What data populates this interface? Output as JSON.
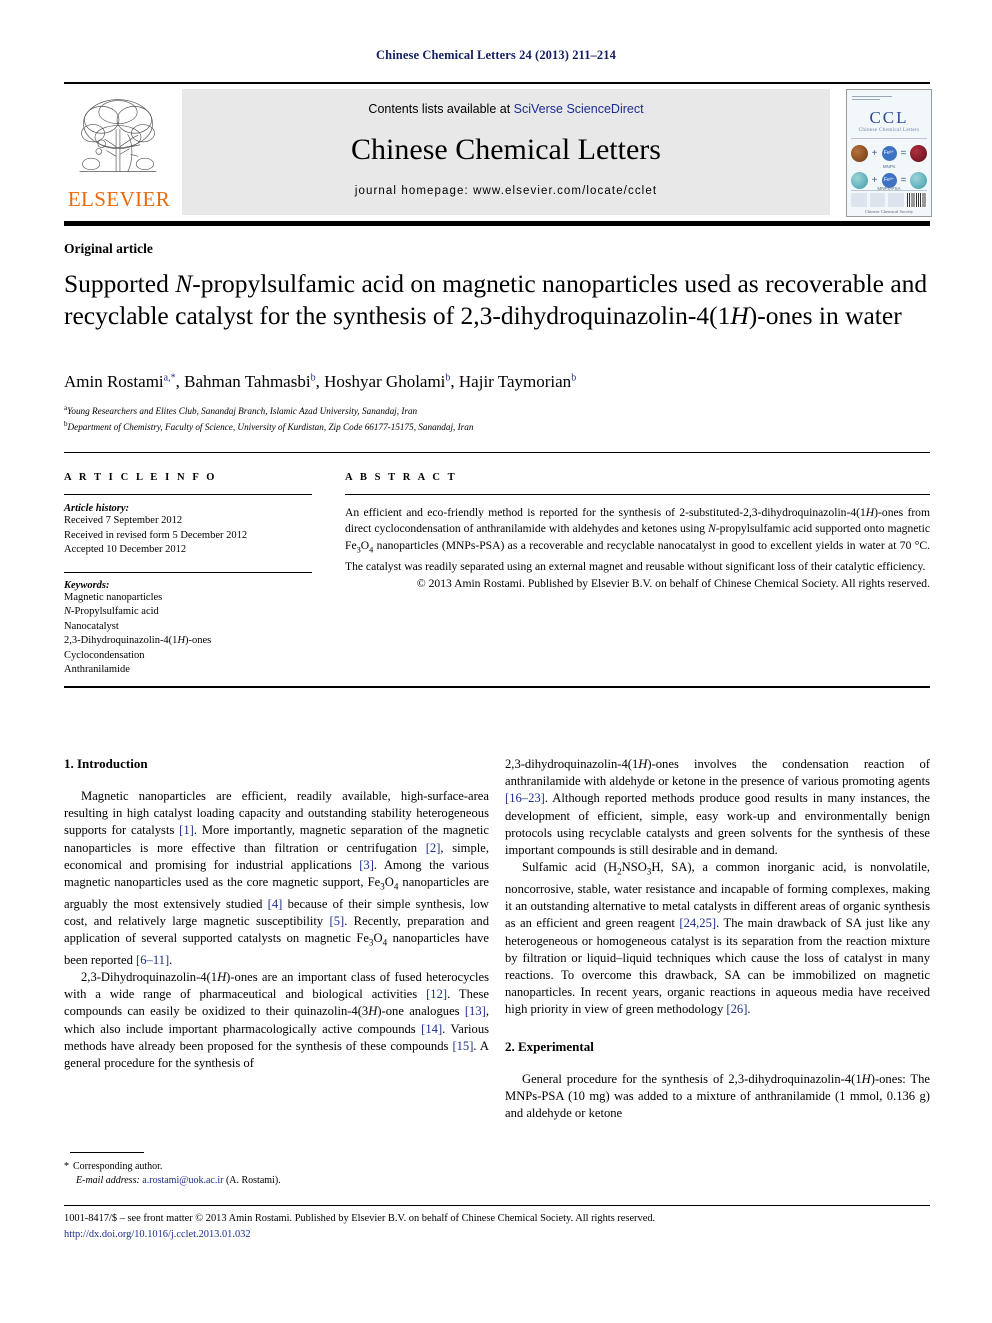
{
  "running_head": "Chinese Chemical Letters 24 (2013) 211–214",
  "masthead": {
    "publisher_name": "ELSEVIER",
    "contents_prefix": "Contents lists available at ",
    "contents_link": "SciVerse ScienceDirect",
    "journal_title": "Chinese Chemical Letters",
    "homepage": "journal homepage: www.elsevier.com/locate/cclet",
    "cover": {
      "acronym": "CCL",
      "subtitle": "Chinese Chemical Letters",
      "caption_1": "MNPs",
      "caption_2": "MNPs-PSA",
      "footer": "Chinese Chemical Society",
      "ion_label": "Fe³⁺"
    },
    "link_color": "#1c2e8c",
    "elsevier_orange": "#eb6909",
    "band_color": "#e8e8e8"
  },
  "article": {
    "type": "Original article",
    "title_part1": "Supported ",
    "title_italic1": "N",
    "title_part2": "-propylsulfamic acid on magnetic nanoparticles used as recoverable and recyclable catalyst for the synthesis of 2,3-dihydroquinazolin-4(1",
    "title_italic2": "H",
    "title_part3": ")-ones in water",
    "authors_plain": "Amin Rostami a,*, Bahman Tahmasbi b, Hoshyar Gholami b, Hajir Taymorian b",
    "authors": [
      {
        "name": "Amin Rostami",
        "marks": "a,*"
      },
      {
        "name": "Bahman Tahmasbi",
        "marks": "b"
      },
      {
        "name": "Hoshyar Gholami",
        "marks": "b"
      },
      {
        "name": "Hajir Taymorian",
        "marks": "b"
      }
    ],
    "affiliations": [
      {
        "mark": "a",
        "text": "Young Researchers and Elites Club, Sanandaj Branch, Islamic Azad University, Sanandaj, Iran"
      },
      {
        "mark": "b",
        "text": "Department of Chemistry, Faculty of Science, University of Kurdistan, Zip Code 66177-15175, Sanandaj, Iran"
      }
    ]
  },
  "article_info": {
    "label": "A R T I C L E  I N F O",
    "history_head": "Article history:",
    "history": [
      "Received 7 September 2012",
      "Received in revised form 5 December 2012",
      "Accepted 10 December 2012"
    ],
    "keywords_head": "Keywords:",
    "keywords": [
      "Magnetic nanoparticles",
      "N-Propylsulfamic acid",
      "Nanocatalyst",
      "2,3-Dihydroquinazolin-4(1H)-ones",
      "Cyclocondensation",
      "Anthranilamide"
    ]
  },
  "abstract": {
    "label": "A B S T R A C T",
    "body": "An efficient and eco-friendly method is reported for the synthesis of 2-substituted-2,3-dihydroquinazolin-4(1H)-ones from direct cyclocondensation of anthranilamide with aldehydes and ketones using N-propylsulfamic acid supported onto magnetic Fe3O4 nanoparticles (MNPs-PSA) as a recoverable and recyclable nanocatalyst in good to excellent yields in water at 70 °C. The catalyst was readily separated using an external magnet and reusable without significant loss of their catalytic efficiency.",
    "copyright": "© 2013 Amin Rostami. Published by Elsevier B.V. on behalf of Chinese Chemical Society. All rights reserved."
  },
  "sections": {
    "introduction_title": "1.  Introduction",
    "experimental_title": "2.  Experimental",
    "left_paragraphs": [
      "Magnetic nanoparticles are efficient, readily available, high-surface-area resulting in high catalyst loading capacity and outstanding stability heterogeneous supports for catalysts [1]. More importantly, magnetic separation of the magnetic nanoparticles is more effective than filtration or centrifugation [2], simple, economical and promising for industrial applications [3]. Among the various magnetic nanoparticles used as the core magnetic support, Fe3O4 nanoparticles are arguably the most extensively studied [4] because of their simple synthesis, low cost, and relatively large magnetic susceptibility [5]. Recently, preparation and application of several supported catalysts on magnetic Fe3O4 nanoparticles have been reported [6–11].",
      "2,3-Dihydroquinazolin-4(1H)-ones are an important class of fused heterocycles with a wide range of pharmaceutical and biological activities [12]. These compounds can easily be oxidized to their quinazolin-4(3H)-one analogues [13], which also include important pharmacologically active compounds [14]. Various methods have already been proposed for the synthesis of these compounds [15]. A general procedure for the synthesis of"
    ],
    "right_paragraphs": [
      "2,3-dihydroquinazolin-4(1H)-ones involves the condensation reaction of anthranilamide with aldehyde or ketone in the presence of various promoting agents [16–23]. Although reported methods produce good results in many instances, the development of efficient, simple, easy work-up and environmentally benign protocols using recyclable catalysts and green solvents for the synthesis of these important compounds is still desirable and in demand.",
      "Sulfamic acid (H2NSO3H, SA), a common inorganic acid, is nonvolatile, noncorrosive, stable, water resistance and incapable of forming complexes, making it an outstanding alternative to metal catalysts in different areas of organic synthesis as an efficient and green reagent [24,25]. The main drawback of SA just like any heterogeneous or homogeneous catalyst is its separation from the reaction mixture by filtration or liquid–liquid techniques which cause the loss of catalyst in many reactions. To overcome this drawback, SA can be immobilized on magnetic nanoparticles. In recent years, organic reactions in aqueous media have received high priority in view of green methodology [26]."
    ],
    "experimental_paragraph": "General procedure for the synthesis of 2,3-dihydroquinazolin-4(1H)-ones: The MNPs-PSA (10 mg) was added to a mixture of anthranilamide (1 mmol, 0.136 g) and aldehyde or ketone"
  },
  "footnote": {
    "marker": "*",
    "corresponding": "Corresponding author.",
    "email_label": "E-mail address:",
    "email": "a.rostami@uok.ac.ir",
    "email_owner": "(A. Rostami)."
  },
  "footer": {
    "copyright": "1001-8417/$ – see front matter © 2013 Amin Rostami. Published by Elsevier B.V. on behalf of Chinese Chemical Society. All rights reserved.",
    "doi": "http://dx.doi.org/10.1016/j.cclet.2013.01.032"
  }
}
